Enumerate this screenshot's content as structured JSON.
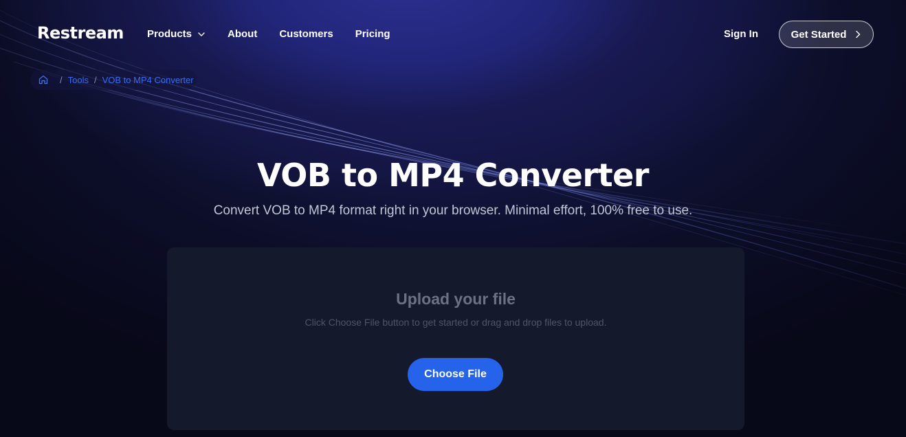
{
  "nav": {
    "logo": "Restream",
    "links": [
      {
        "label": "Products",
        "has_dropdown": true
      },
      {
        "label": "About"
      },
      {
        "label": "Customers"
      },
      {
        "label": "Pricing"
      }
    ],
    "sign_in": "Sign In",
    "get_started": "Get Started"
  },
  "breadcrumb": {
    "home_icon": "home-icon",
    "items": [
      "Tools",
      "VOB to MP4 Converter"
    ],
    "separator": "/"
  },
  "hero": {
    "title": "VOB to MP4 Converter",
    "subtitle": "Convert VOB to MP4 format right in your browser. Minimal effort, 100% free to use."
  },
  "upload": {
    "title": "Upload your file",
    "hint": "Click Choose File button to get started or drag and drop files to upload.",
    "button": "Choose File"
  },
  "colors": {
    "accent": "#2563eb",
    "breadcrumb_link": "#3d6cf0",
    "card_bg": "#141a2b",
    "page_bg": "#070818"
  }
}
